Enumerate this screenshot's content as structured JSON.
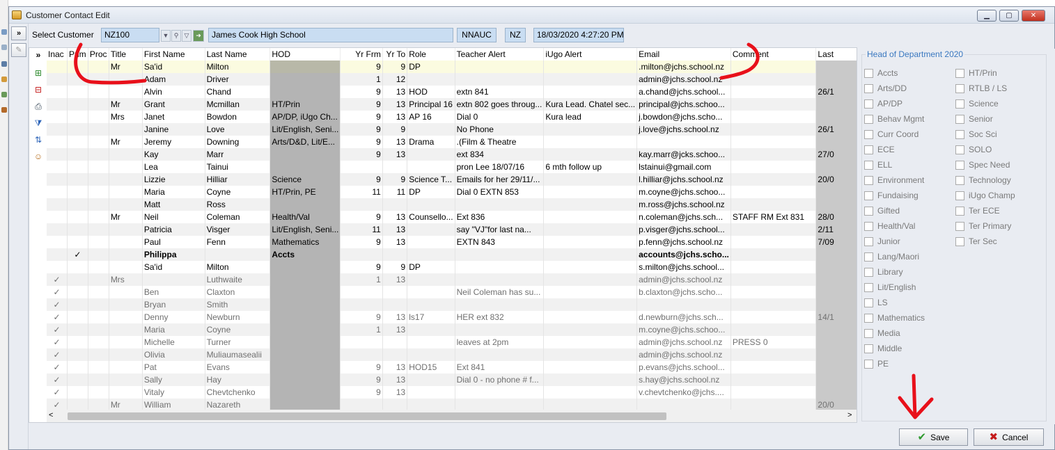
{
  "window": {
    "title": "Customer Contact Edit",
    "minimize": "▁",
    "maximize": "▢",
    "close": "✕"
  },
  "toolbar": {
    "expand": "»",
    "select_customer_label": "Select Customer",
    "customer_code": "NZ100",
    "school_name": "James Cook High School",
    "region_code": "NNAUC",
    "country": "NZ",
    "timestamp": "18/03/2020 4:27:20 PM"
  },
  "grid": {
    "expand": "»",
    "columns": [
      "Inac",
      "Prim",
      "Proc",
      "Title",
      "First Name",
      "Last Name",
      "HOD",
      "Yr Frm",
      "Yr To",
      "Role",
      "Teacher Alert",
      "iUgo Alert",
      "Email",
      "Comment",
      "Last"
    ],
    "rows": [
      {
        "inac": "",
        "prim": "",
        "proc": "",
        "title": "Mr",
        "first": "Sa'id",
        "last": "Milton",
        "hod": "",
        "yrfrm": "9",
        "yrto": "9",
        "role": "DP",
        "teacher": "",
        "iugo": "",
        "email": ".milton@jchs.school.nz",
        "comment": "",
        "lastc": "",
        "state": "selected"
      },
      {
        "inac": "",
        "prim": "",
        "proc": "",
        "title": "",
        "first": "Adam",
        "last": "Driver",
        "hod": "",
        "yrfrm": "1",
        "yrto": "12",
        "role": "",
        "teacher": "",
        "iugo": "",
        "email": "admin@jchs.school.nz",
        "comment": "",
        "lastc": "",
        "state": ""
      },
      {
        "inac": "",
        "prim": "",
        "proc": "",
        "title": "",
        "first": "Alvin",
        "last": "Chand",
        "hod": "",
        "yrfrm": "9",
        "yrto": "13",
        "role": "HOD",
        "teacher": "extn 841",
        "iugo": "",
        "email": "a.chand@jchs.school...",
        "comment": "",
        "lastc": "26/1",
        "state": ""
      },
      {
        "inac": "",
        "prim": "",
        "proc": "",
        "title": "Mr",
        "first": "Grant",
        "last": "Mcmillan",
        "hod": "HT/Prin",
        "yrfrm": "9",
        "yrto": "13",
        "role": "Principal 16",
        "teacher": "extn 802 goes throug...",
        "iugo": "Kura Lead. Chatel sec...",
        "email": "principal@jchs.schoo...",
        "comment": "",
        "lastc": "",
        "state": ""
      },
      {
        "inac": "",
        "prim": "",
        "proc": "",
        "title": "Mrs",
        "first": "Janet",
        "last": "Bowdon",
        "hod": "AP/DP, iUgo Ch...",
        "yrfrm": "9",
        "yrto": "13",
        "role": "AP 16",
        "teacher": "Dial 0",
        "iugo": "Kura lead",
        "email": "j.bowdon@jchs.scho...",
        "comment": "",
        "lastc": "",
        "state": ""
      },
      {
        "inac": "",
        "prim": "",
        "proc": "",
        "title": "",
        "first": "Janine",
        "last": "Love",
        "hod": "Lit/English, Seni...",
        "yrfrm": "9",
        "yrto": "9",
        "role": "",
        "teacher": "No Phone",
        "iugo": "",
        "email": "j.love@jchs.school.nz",
        "comment": "",
        "lastc": "26/1",
        "state": ""
      },
      {
        "inac": "",
        "prim": "",
        "proc": "",
        "title": "Mr",
        "first": "Jeremy",
        "last": "Downing",
        "hod": "Arts/D&D, Lit/E...",
        "yrfrm": "9",
        "yrto": "13",
        "role": "Drama",
        "teacher": ".(Film & Theatre",
        "iugo": "",
        "email": "",
        "comment": "",
        "lastc": "",
        "state": ""
      },
      {
        "inac": "",
        "prim": "",
        "proc": "",
        "title": "",
        "first": "Kay",
        "last": "Marr",
        "hod": "",
        "yrfrm": "9",
        "yrto": "13",
        "role": "",
        "teacher": "ext 834",
        "iugo": "",
        "email": "kay.marr@jcks.schoo...",
        "comment": "",
        "lastc": "27/0",
        "state": ""
      },
      {
        "inac": "",
        "prim": "",
        "proc": "",
        "title": "",
        "first": "Lea",
        "last": "Tainui",
        "hod": "",
        "yrfrm": "",
        "yrto": "",
        "role": "",
        "teacher": "pron Lee 18/07/16",
        "iugo": "6 mth follow up",
        "email": "lstainui@gmail.com",
        "comment": "",
        "lastc": "",
        "state": ""
      },
      {
        "inac": "",
        "prim": "",
        "proc": "",
        "title": "",
        "first": "Lizzie",
        "last": "Hilliar",
        "hod": "Science",
        "yrfrm": "9",
        "yrto": "9",
        "role": "Science T...",
        "teacher": "Emails for her 29/11/...",
        "iugo": "",
        "email": "l.hilliar@jchs.school.nz",
        "comment": "",
        "lastc": "20/0",
        "state": ""
      },
      {
        "inac": "",
        "prim": "",
        "proc": "",
        "title": "",
        "first": "Maria",
        "last": "Coyne",
        "hod": "HT/Prin, PE",
        "yrfrm": "11",
        "yrto": "11",
        "role": "DP",
        "teacher": "Dial 0 EXTN 853",
        "iugo": "",
        "email": "m.coyne@jchs.schoo...",
        "comment": "",
        "lastc": "",
        "state": ""
      },
      {
        "inac": "",
        "prim": "",
        "proc": "",
        "title": "",
        "first": "Matt",
        "last": "Ross",
        "hod": "",
        "yrfrm": "",
        "yrto": "",
        "role": "",
        "teacher": "",
        "iugo": "",
        "email": "m.ross@jchs.school.nz",
        "comment": "",
        "lastc": "",
        "state": ""
      },
      {
        "inac": "",
        "prim": "",
        "proc": "",
        "title": "Mr",
        "first": "Neil",
        "last": "Coleman",
        "hod": "Health/Val",
        "yrfrm": "9",
        "yrto": "13",
        "role": "Counsello...",
        "teacher": "Ext 836",
        "iugo": "",
        "email": "n.coleman@jchs.sch...",
        "comment": "STAFF RM Ext 831",
        "lastc": "28/0",
        "state": ""
      },
      {
        "inac": "",
        "prim": "",
        "proc": "",
        "title": "",
        "first": "Patricia",
        "last": "Visger",
        "hod": "Lit/English, Seni...",
        "yrfrm": "11",
        "yrto": "13",
        "role": "",
        "teacher": "   say \"VJ\"for last na...",
        "iugo": "",
        "email": "p.visger@jchs.school...",
        "comment": "",
        "lastc": "2/11",
        "state": ""
      },
      {
        "inac": "",
        "prim": "",
        "proc": "",
        "title": "",
        "first": "Paul",
        "last": "Fenn",
        "hod": "Mathematics",
        "yrfrm": "9",
        "yrto": "13",
        "role": "",
        "teacher": "EXTN 843",
        "iugo": "",
        "email": "p.fenn@jchs.school.nz",
        "comment": "",
        "lastc": "7/09",
        "state": ""
      },
      {
        "inac": "",
        "prim": "✓",
        "proc": "",
        "title": "",
        "first": "Philippa",
        "last": "",
        "hod": "Accts",
        "yrfrm": "",
        "yrto": "",
        "role": "",
        "teacher": "",
        "iugo": "",
        "email": "accounts@jchs.scho...",
        "comment": "",
        "lastc": "",
        "state": "bold"
      },
      {
        "inac": "",
        "prim": "",
        "proc": "",
        "title": "",
        "first": "Sa'id",
        "last": "Milton",
        "hod": "",
        "yrfrm": "9",
        "yrto": "9",
        "role": "DP",
        "teacher": "",
        "iugo": "",
        "email": "s.milton@jchs.school...",
        "comment": "",
        "lastc": "",
        "state": ""
      },
      {
        "inac": "✓",
        "prim": "",
        "proc": "",
        "title": "Mrs",
        "first": "",
        "last": "Luthwaite",
        "hod": "",
        "yrfrm": "1",
        "yrto": "13",
        "role": "",
        "teacher": "",
        "iugo": "",
        "email": "admin@jchs.school.nz",
        "comment": "",
        "lastc": "",
        "state": "inactive"
      },
      {
        "inac": "✓",
        "prim": "",
        "proc": "",
        "title": "",
        "first": "Ben",
        "last": "Claxton",
        "hod": "",
        "yrfrm": "",
        "yrto": "",
        "role": "",
        "teacher": "Neil Coleman has su...",
        "iugo": "",
        "email": "b.claxton@jchs.scho...",
        "comment": "",
        "lastc": "",
        "state": "inactive"
      },
      {
        "inac": "✓",
        "prim": "",
        "proc": "",
        "title": "",
        "first": "Bryan",
        "last": "Smith",
        "hod": "",
        "yrfrm": "",
        "yrto": "",
        "role": "",
        "teacher": "",
        "iugo": "",
        "email": "",
        "comment": "",
        "lastc": "",
        "state": "inactive"
      },
      {
        "inac": "✓",
        "prim": "",
        "proc": "",
        "title": "",
        "first": "Denny",
        "last": "Newburn",
        "hod": "",
        "yrfrm": "9",
        "yrto": "13",
        "role": "ls17",
        "teacher": "HER   ext 832",
        "iugo": "",
        "email": "d.newburn@jchs.sch...",
        "comment": "",
        "lastc": "14/1",
        "state": "inactive"
      },
      {
        "inac": "✓",
        "prim": "",
        "proc": "",
        "title": "",
        "first": "Maria",
        "last": "Coyne",
        "hod": "",
        "yrfrm": "1",
        "yrto": "13",
        "role": "",
        "teacher": "",
        "iugo": "",
        "email": "m.coyne@jchs.schoo...",
        "comment": "",
        "lastc": "",
        "state": "inactive"
      },
      {
        "inac": "✓",
        "prim": "",
        "proc": "",
        "title": "",
        "first": "Michelle",
        "last": "Turner",
        "hod": "",
        "yrfrm": "",
        "yrto": "",
        "role": "",
        "teacher": "leaves at 2pm",
        "iugo": "",
        "email": "admin@jchs.school.nz",
        "comment": "PRESS 0",
        "lastc": "",
        "state": "inactive"
      },
      {
        "inac": "✓",
        "prim": "",
        "proc": "",
        "title": "",
        "first": "Olivia",
        "last": "Muliaumasealii",
        "hod": "",
        "yrfrm": "",
        "yrto": "",
        "role": "",
        "teacher": "",
        "iugo": "",
        "email": "admin@jchs.school.nz",
        "comment": "",
        "lastc": "",
        "state": "inactive"
      },
      {
        "inac": "✓",
        "prim": "",
        "proc": "",
        "title": "",
        "first": "Pat",
        "last": "Evans",
        "hod": "",
        "yrfrm": "9",
        "yrto": "13",
        "role": "HOD15",
        "teacher": "Ext 841",
        "iugo": "",
        "email": "p.evans@jchs.school...",
        "comment": "",
        "lastc": "",
        "state": "inactive"
      },
      {
        "inac": "✓",
        "prim": "",
        "proc": "",
        "title": "",
        "first": "Sally",
        "last": "Hay",
        "hod": "",
        "yrfrm": "9",
        "yrto": "13",
        "role": "",
        "teacher": "Dial 0 - no phone # f...",
        "iugo": "",
        "email": "s.hay@jchs.school.nz",
        "comment": "",
        "lastc": "",
        "state": "inactive"
      },
      {
        "inac": "✓",
        "prim": "",
        "proc": "",
        "title": "",
        "first": "Vitaly",
        "last": "Chevtchenko",
        "hod": "",
        "yrfrm": "9",
        "yrto": "13",
        "role": "",
        "teacher": "",
        "iugo": "",
        "email": "v.chevtchenko@jchs....",
        "comment": "",
        "lastc": "",
        "state": "inactive"
      },
      {
        "inac": "✓",
        "prim": "",
        "proc": "",
        "title": "Mr",
        "first": "William",
        "last": "Nazareth",
        "hod": "",
        "yrfrm": "",
        "yrto": "",
        "role": "",
        "teacher": "",
        "iugo": "",
        "email": "",
        "comment": "",
        "lastc": "20/0",
        "state": "inactive"
      }
    ],
    "scroll_left": "<",
    "scroll_right": ">"
  },
  "hod_panel": {
    "title": "Head of Department 2020",
    "col1": [
      "Accts",
      "Arts/DD",
      "AP/DP",
      "Behav Mgmt",
      "Curr Coord",
      "ECE",
      "ELL",
      "Environment",
      "Fundaising",
      "Gifted",
      "Health/Val",
      "Junior",
      "Lang/Maori",
      "Library",
      "Lit/English",
      "LS",
      "Mathematics",
      "Media",
      "Middle",
      "PE"
    ],
    "col2": [
      "HT/Prin",
      "RTLB / LS",
      "Science",
      "Senior",
      "Soc Sci",
      "SOLO",
      "Spec Need",
      "Technology",
      "iUgo Champ",
      "Ter ECE",
      "Ter Primary",
      "Ter Sec"
    ]
  },
  "footer": {
    "save_label": "Save",
    "cancel_label": "Cancel"
  },
  "colors": {
    "accent": "#3a78c0",
    "field_bg": "#c9ddf2",
    "annotation": "#e8101a",
    "save_icon": "#2e9a2e",
    "cancel_icon": "#c41a1a"
  }
}
